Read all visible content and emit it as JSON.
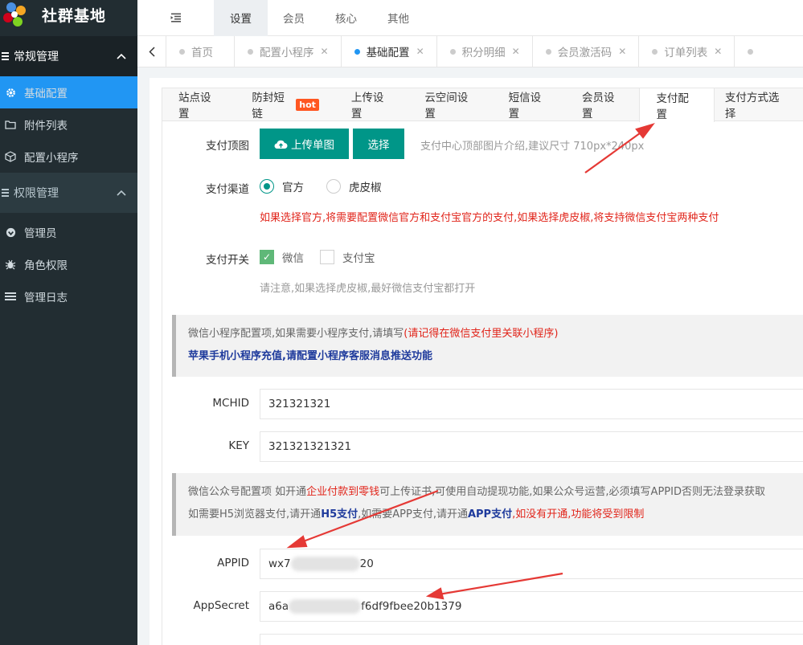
{
  "brand": {
    "title": "社群基地"
  },
  "sidebar": {
    "groups": [
      {
        "label": "常规管理",
        "items": [
          {
            "label": "基础配置",
            "icon": "gear-icon"
          },
          {
            "label": "附件列表",
            "icon": "folder-icon"
          },
          {
            "label": "配置小程序",
            "icon": "cube-icon"
          }
        ]
      },
      {
        "label": "权限管理",
        "items": [
          {
            "label": "管理员",
            "icon": "user-circle-icon"
          },
          {
            "label": "角色权限",
            "icon": "bug-icon"
          },
          {
            "label": "管理日志",
            "icon": "list-icon"
          }
        ]
      }
    ]
  },
  "topnav": {
    "tabs": [
      "设置",
      "会员",
      "核心",
      "其他"
    ]
  },
  "pagetabs": [
    "首页",
    "配置小程序",
    "基础配置",
    "积分明细",
    "会员激活码",
    "订单列表"
  ],
  "subtabs": [
    "站点设置",
    "防封短链",
    "上传设置",
    "云空间设置",
    "短信设置",
    "会员设置",
    "支付配置",
    "支付方式选择"
  ],
  "hot_badge": "hot",
  "form": {
    "pay_banner_label": "支付顶图",
    "upload_button": "上传单图",
    "select_button": "选择",
    "banner_hint": "支付中心顶部图片介绍,建议尺寸 710px*240px",
    "channel_label": "支付渠道",
    "channel_official": "官方",
    "channel_tiger": "虎皮椒",
    "channel_warning": "如果选择官方,将需要配置微信官方和支付宝官方的支付,如果选择虎皮椒,将支持微信支付宝两种支付",
    "switch_label": "支付开关",
    "switch_wechat": "微信",
    "switch_alipay": "支付宝",
    "switch_hint": "请注意,如果选择虎皮椒,最好微信支付宝都打开",
    "mini_notice_1": "微信小程序配置项,如果需要小程序支付,请填写",
    "mini_notice_1_red": "(请记得在微信支付里关联小程序)",
    "mini_notice_2": "苹果手机小程序充值,请配置小程序客服消息推送功能",
    "mchid_label": "MCHID",
    "mchid_value": "321321321",
    "key_label": "KEY",
    "key_value": "321321321321",
    "mp_notice_a": "微信公众号配置项 如开通",
    "mp_notice_a_red": "企业付款到零钱",
    "mp_notice_a_rest": "可上传证书,可使用自动提现功能,如果公众号运营,必须填写APPID否则无法登录获取",
    "mp_notice_b1": "如需要H5浏览器支付,请开通",
    "mp_notice_b_h5": "H5支付",
    "mp_notice_b2": ",如需要APP支付,请开通",
    "mp_notice_b_app": "APP支付",
    "mp_notice_b3": ",如没有开通,功能将受到限制",
    "appid_label": "APPID",
    "appid_prefix": "wx7",
    "appid_suffix": "20",
    "appsecret_label": "AppSecret",
    "appsecret_prefix": "a6a",
    "appsecret_suffix": "f6df9fbee20b1379"
  },
  "colors": {
    "sidebar_bg": "#222d32",
    "active_blue": "#2196f3",
    "green": "#009688",
    "red": "#e1251b",
    "annotation": "#e53935"
  }
}
